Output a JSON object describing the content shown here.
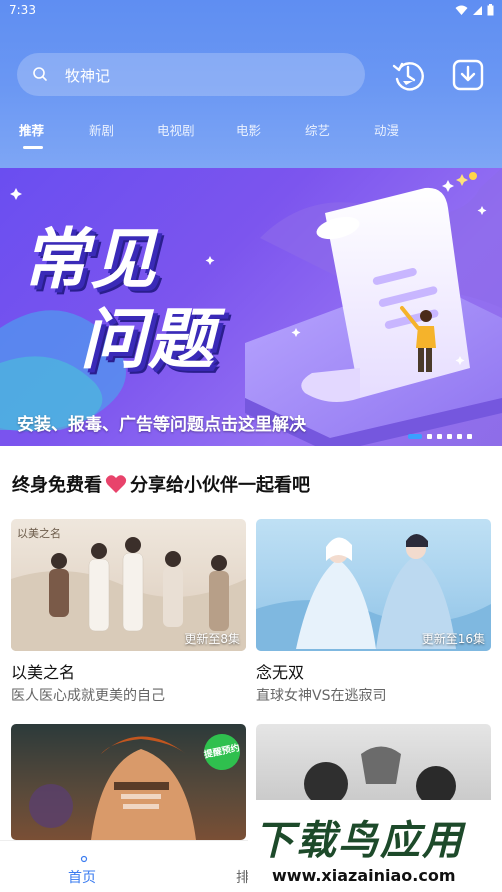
{
  "status_bar": {
    "time": "7:33"
  },
  "search": {
    "text": "牧神记"
  },
  "tabs": [
    {
      "label": "推荐"
    },
    {
      "label": "新剧"
    },
    {
      "label": "电视剧"
    },
    {
      "label": "电影"
    },
    {
      "label": "综艺"
    },
    {
      "label": "动漫"
    }
  ],
  "banner": {
    "title_line1": "常见",
    "title_line2": "问题",
    "caption": "安装、报毒、广告等问题点击这里解决",
    "slide_count": 6,
    "active_slide": 1
  },
  "section": {
    "heading_left": "终身免费看",
    "heading_right": "分享给小伙伴一起看吧"
  },
  "cards": [
    {
      "title": "以美之名",
      "subtitle": "医人医心成就更美的自己",
      "badge": "更新至8集",
      "poster_text": "以美之名"
    },
    {
      "title": "念无双",
      "subtitle": "直球女神VS在逃寂司",
      "badge": "更新至16集"
    },
    {
      "promo": "提醒预约"
    },
    {}
  ],
  "bottom_nav": {
    "home": "首页",
    "rank": "排"
  },
  "watermark": {
    "brand": "下载鸟应用",
    "url": "www.xiazainiao.com"
  },
  "colors": {
    "accent": "#3b7cf0",
    "header_top": "#5f8ef2",
    "banner": "#7c55ee",
    "heart": "#e8436b"
  }
}
